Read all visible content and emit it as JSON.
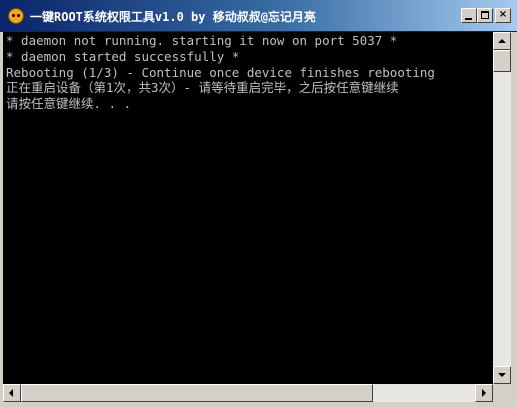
{
  "window": {
    "title": "一键ROOT系统权限工具v1.0 by 移动叔叔@忘记月亮",
    "minimize_label": "",
    "maximize_label": "",
    "close_label": "×"
  },
  "console": {
    "lines": [
      "* daemon not running. starting it now on port 5037 *",
      "* daemon started successfully *",
      "Rebooting (1/3) - Continue once device finishes rebooting",
      "正在重启设备（第1次，共3次）- 请等待重启完毕，之后按任意键继续",
      "请按任意键继续. . ."
    ]
  },
  "colors": {
    "console_bg": "#000000",
    "console_text": "#c0c0c0",
    "titlebar_start": "#0a246a",
    "titlebar_end": "#a6caf0"
  },
  "icons": {
    "app": "smiley-app-icon",
    "minimize": "minimize-icon",
    "maximize": "maximize-icon",
    "close": "close-icon",
    "scroll_up": "arrow-up-icon",
    "scroll_down": "arrow-down-icon",
    "scroll_left": "arrow-left-icon",
    "scroll_right": "arrow-right-icon"
  }
}
